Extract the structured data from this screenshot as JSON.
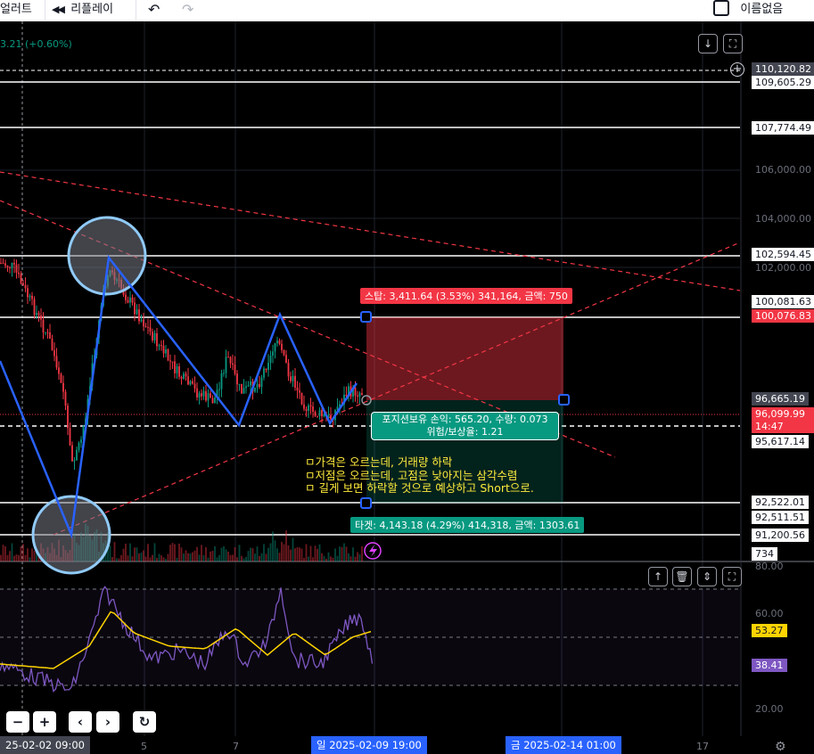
{
  "toolbar": {
    "alert_label": "얼러트",
    "replay_label": "리플레이",
    "unnamed_label": "이름없음"
  },
  "price_change": "3.21 (+0.60%)",
  "price_axis": {
    "labels": [
      "110,120.82",
      "109,605.29",
      "107,774.49",
      "106,000.00",
      "104,000.00",
      "102,594.45",
      "102,000.00",
      "100,081.63",
      "100,076.83",
      "96,665.19",
      "96,099.99",
      "14:47",
      "95,617.14",
      "92,522.01",
      "92,511.51",
      "91,200.56",
      "734"
    ]
  },
  "position": {
    "stop_text": "스탑: 3,411.64 (3.53%) 341,164, 금액: 750",
    "target_text": "타겟: 4,143.18 (4.29%) 414,318, 금액: 1303.61",
    "pnl_text": "포지션보유 손익: 565.20, 수량: 0.073",
    "ratio_text": "위험/보상율: 1.21"
  },
  "note": {
    "line1": "ㅁ가격은 오르는데, 거래량 하락",
    "line2": "ㅁ저점은 오르는데, 고점은 낮아지는 삼각수렴",
    "line3": "ㅁ 길게 보면 하락할 것으로 예상하고 Short으로."
  },
  "indicator": {
    "axis_labels": [
      "80.00",
      "60.00",
      "20.00"
    ],
    "ma_value": "53.27",
    "rsi_value": "38.41",
    "colors": {
      "rsi": "#7e57c2",
      "ma": "#ffd400"
    }
  },
  "time_axis": {
    "left_label": "25-02-02   09:00",
    "ticks": [
      "5",
      "7",
      "17"
    ],
    "crosshair_start": "일 2025-02-09   19:00",
    "crosshair_end": "금 2025-02-14   01:00"
  },
  "colors": {
    "up": "#089981",
    "down": "#f23645",
    "pattern": "#2962ff",
    "circle": "#90caf9"
  }
}
